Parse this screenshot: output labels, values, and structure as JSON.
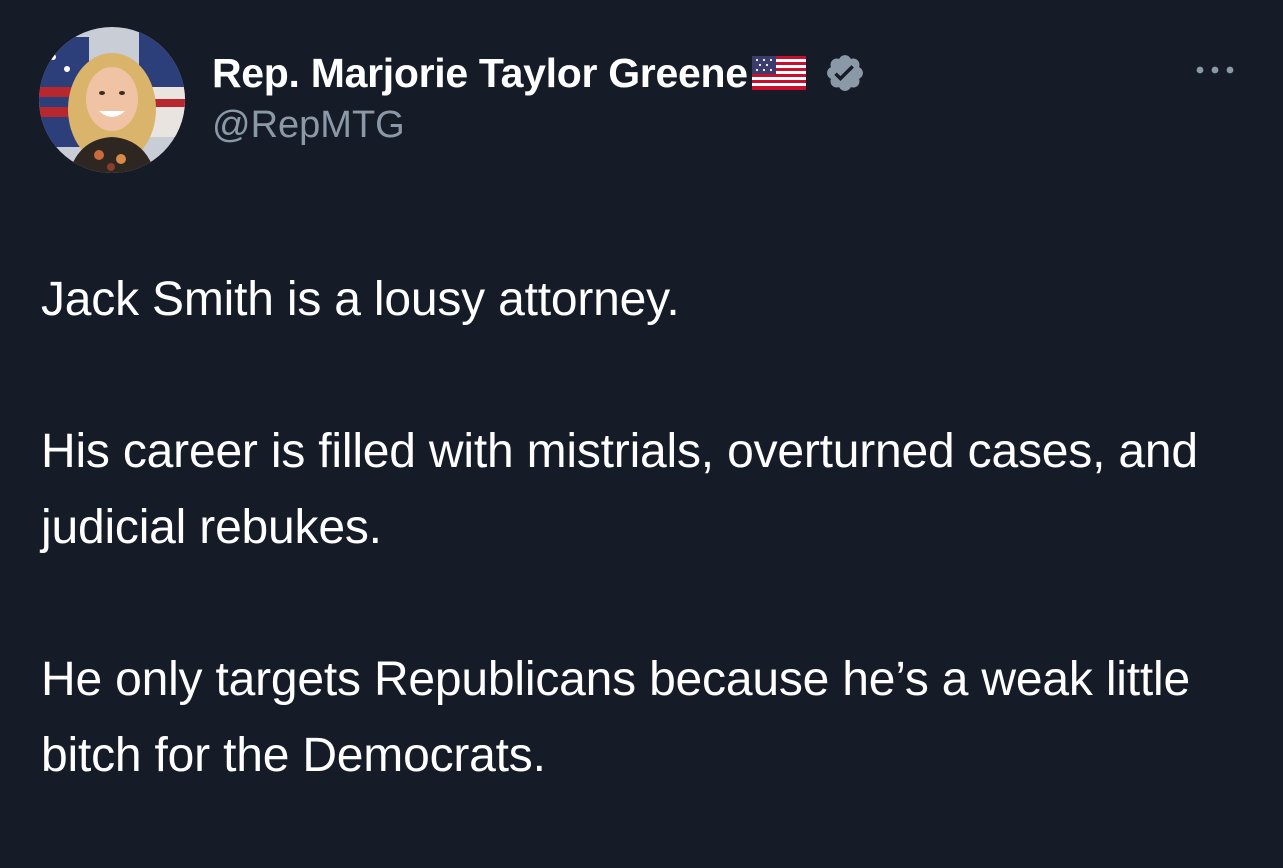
{
  "tweet": {
    "author": {
      "display_name": "Rep. Marjorie Taylor Greene",
      "handle": "@RepMTG",
      "flag_icon": "us-flag-icon",
      "verified_icon": "verified-badge-icon",
      "verified_color": "#8b98a5"
    },
    "more_icon": "more-options-icon",
    "paragraphs": [
      "Jack Smith is a lousy attorney.",
      "His career is filled with mistrials, overturned cases, and judicial rebukes.",
      "He only targets Republicans because he’s a weak little bitch for the Democrats."
    ]
  },
  "colors": {
    "background": "#161b28",
    "text_primary": "#ffffff",
    "text_secondary": "#8b98a5"
  }
}
